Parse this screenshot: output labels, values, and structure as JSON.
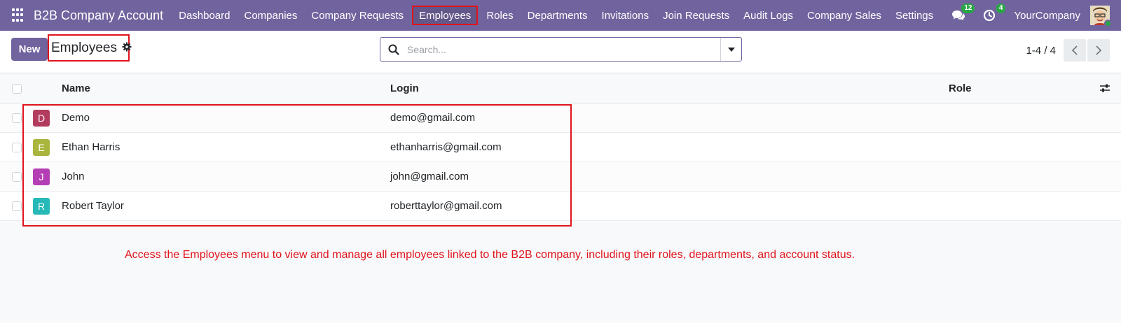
{
  "navbar": {
    "app_title": "B2B Company Account",
    "menu": [
      {
        "label": "Dashboard",
        "active": false
      },
      {
        "label": "Companies",
        "active": false
      },
      {
        "label": "Company Requests",
        "active": false
      },
      {
        "label": "Employees",
        "active": true
      },
      {
        "label": "Roles",
        "active": false
      },
      {
        "label": "Departments",
        "active": false
      },
      {
        "label": "Invitations",
        "active": false
      },
      {
        "label": "Join Requests",
        "active": false
      },
      {
        "label": "Audit Logs",
        "active": false
      },
      {
        "label": "Company Sales",
        "active": false
      },
      {
        "label": "Settings",
        "active": false
      }
    ],
    "messages_count": "12",
    "activities_count": "4",
    "company_name": "YourCompany"
  },
  "control": {
    "new_label": "New",
    "breadcrumb_title": "Employees",
    "search_placeholder": "Search...",
    "pager_value": "1-4 / 4"
  },
  "list": {
    "columns": {
      "name": "Name",
      "login": "Login",
      "role": "Role"
    },
    "rows": [
      {
        "initial": "D",
        "avatar_color": "#b23b5e",
        "name": "Demo",
        "login": "demo@gmail.com"
      },
      {
        "initial": "E",
        "avatar_color": "#a9b53c",
        "name": "Ethan Harris",
        "login": "ethanharris@gmail.com"
      },
      {
        "initial": "J",
        "avatar_color": "#b43fb5",
        "name": "John",
        "login": "john@gmail.com"
      },
      {
        "initial": "R",
        "avatar_color": "#27b8b8",
        "name": "Robert Taylor",
        "login": "roberttaylor@gmail.com"
      }
    ]
  },
  "annotation": "Access the Employees menu to view and manage all employees linked to the B2B company, including their roles, departments, and account status.",
  "colors": {
    "brand": "#71639e",
    "highlight": "#e0141c",
    "badge": "#28a745"
  }
}
